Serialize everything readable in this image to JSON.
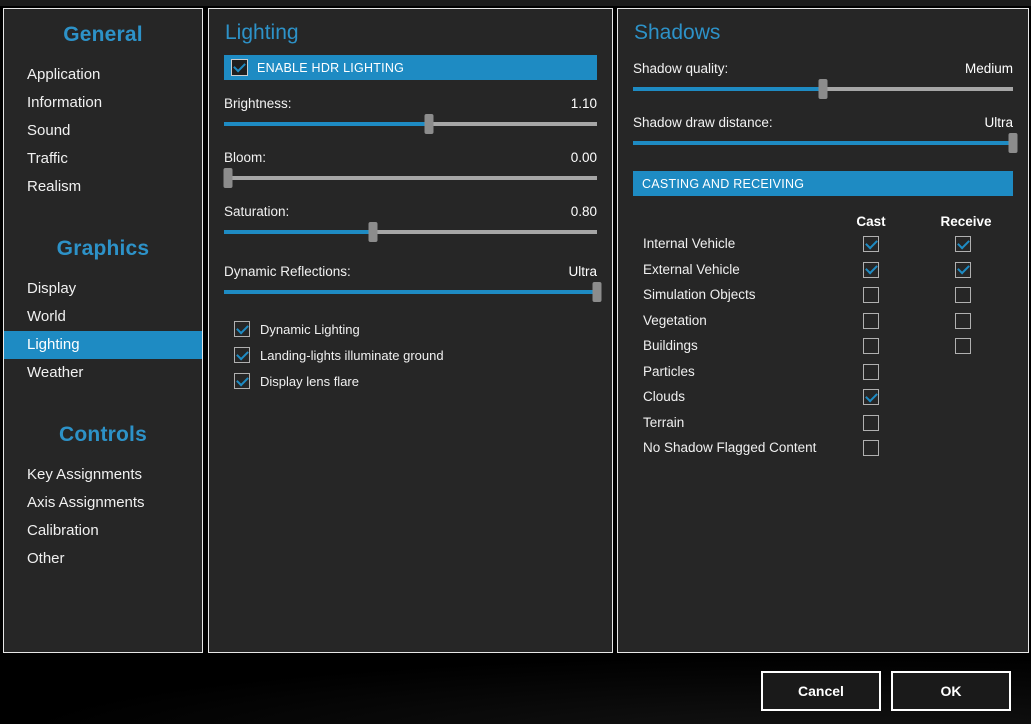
{
  "sidebar": {
    "groups": [
      {
        "title": "General",
        "items": [
          {
            "label": "Application",
            "selected": false
          },
          {
            "label": "Information",
            "selected": false
          },
          {
            "label": "Sound",
            "selected": false
          },
          {
            "label": "Traffic",
            "selected": false
          },
          {
            "label": "Realism",
            "selected": false
          }
        ]
      },
      {
        "title": "Graphics",
        "items": [
          {
            "label": "Display",
            "selected": false
          },
          {
            "label": "World",
            "selected": false
          },
          {
            "label": "Lighting",
            "selected": true
          },
          {
            "label": "Weather",
            "selected": false
          }
        ]
      },
      {
        "title": "Controls",
        "items": [
          {
            "label": "Key Assignments",
            "selected": false
          },
          {
            "label": "Axis Assignments",
            "selected": false
          },
          {
            "label": "Calibration",
            "selected": false
          },
          {
            "label": "Other",
            "selected": false
          }
        ]
      }
    ]
  },
  "lighting": {
    "title": "Lighting",
    "hdr": {
      "label": "ENABLE HDR LIGHTING",
      "checked": true
    },
    "sliders": [
      {
        "label": "Brightness:",
        "value": "1.10",
        "percent": 55
      },
      {
        "label": "Bloom:",
        "value": "0.00",
        "percent": 1
      },
      {
        "label": "Saturation:",
        "value": "0.80",
        "percent": 40
      }
    ],
    "reflections": {
      "label": "Dynamic Reflections:",
      "value": "Ultra",
      "percent": 100
    },
    "options": [
      {
        "label": "Dynamic Lighting",
        "checked": true
      },
      {
        "label": "Landing-lights illuminate ground",
        "checked": true
      },
      {
        "label": "Display lens flare",
        "checked": true
      }
    ]
  },
  "shadows": {
    "title": "Shadows",
    "sliders": [
      {
        "label": "Shadow quality:",
        "value": "Medium",
        "percent": 50
      },
      {
        "label": "Shadow draw distance:",
        "value": "Ultra",
        "percent": 100
      }
    ],
    "section_bar": "CASTING AND RECEIVING",
    "columns": {
      "cast": "Cast",
      "receive": "Receive"
    },
    "rows": [
      {
        "label": "Internal Vehicle",
        "cast": true,
        "has_cast": true,
        "receive": true,
        "has_receive": true
      },
      {
        "label": "External Vehicle",
        "cast": true,
        "has_cast": true,
        "receive": true,
        "has_receive": true
      },
      {
        "label": "Simulation Objects",
        "cast": false,
        "has_cast": true,
        "receive": false,
        "has_receive": true
      },
      {
        "label": "Vegetation",
        "cast": false,
        "has_cast": true,
        "receive": false,
        "has_receive": true
      },
      {
        "label": "Buildings",
        "cast": false,
        "has_cast": true,
        "receive": false,
        "has_receive": true
      },
      {
        "label": "Particles",
        "cast": false,
        "has_cast": true,
        "receive": false,
        "has_receive": false
      },
      {
        "label": "Clouds",
        "cast": true,
        "has_cast": true,
        "receive": false,
        "has_receive": false
      },
      {
        "label": "Terrain",
        "cast": false,
        "has_cast": true,
        "receive": false,
        "has_receive": false
      },
      {
        "label": "No Shadow Flagged Content",
        "cast": false,
        "has_cast": true,
        "receive": false,
        "has_receive": false
      }
    ]
  },
  "footer": {
    "cancel_label": "Cancel",
    "ok_label": "OK"
  },
  "colors": {
    "accent": "#1e8bc3",
    "heading": "#2d92c8",
    "panel_bg": "#262626",
    "page_bg": "#000000",
    "rail": "#a6a6a6",
    "knob": "#8c8c8c"
  }
}
